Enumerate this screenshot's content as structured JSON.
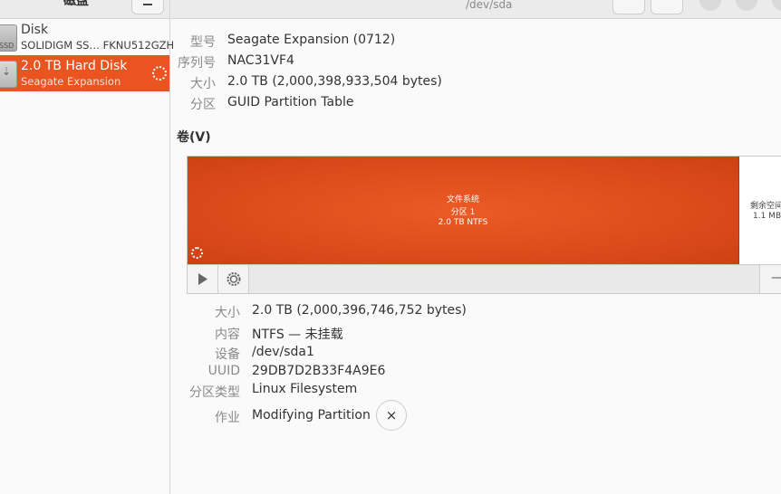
{
  "header": {
    "sidebar_title": "磁盘",
    "subtitle": "/dev/sda"
  },
  "sidebar": {
    "disks": [
      {
        "name": "Disk",
        "subtitle": "SOLIDIGM SS… FKNU512GZH",
        "icon": "ssd-drive-icon",
        "icon_text": "SSD",
        "selected": false
      },
      {
        "name": "2.0 TB Hard Disk",
        "subtitle": "Seagate Expansion",
        "icon": "usb-drive-icon",
        "icon_text": "⇣",
        "selected": true,
        "busy": true
      }
    ]
  },
  "drive": {
    "model_label": "型号",
    "model": "Seagate Expansion (0712)",
    "serial_label": "序列号",
    "serial": "NAC31VF4",
    "size_label": "大小",
    "size": "2.0 TB (2,000,398,933,504 bytes)",
    "partitioning_label": "分区",
    "partitioning": "GUID Partition Table"
  },
  "volumes": {
    "title": "卷(V)",
    "partition": {
      "line1": "文件系统",
      "line2": "分区 1",
      "line3": "2.0 TB NTFS"
    },
    "free_space": {
      "line1": "剩余空间",
      "line2": "1.1 MB"
    },
    "toolbar": {
      "play_icon": "play-icon",
      "settings_icon": "gear-icon",
      "minus": "—"
    }
  },
  "details": {
    "size_label": "大小",
    "size": "2.0 TB (2,000,396,746,752 bytes)",
    "contents_label": "内容",
    "contents": "NTFS — 未挂载",
    "device_label": "设备",
    "device": "/dev/sda1",
    "uuid_label": "UUID",
    "uuid": "29DB7D2B33F4A9E6",
    "type_label": "分区类型",
    "type": "Linux Filesystem",
    "job_label": "作业",
    "job": "Modifying Partition",
    "cancel_symbol": "×"
  },
  "colors": {
    "accent": "#e95420",
    "partition": "#d9481a"
  }
}
